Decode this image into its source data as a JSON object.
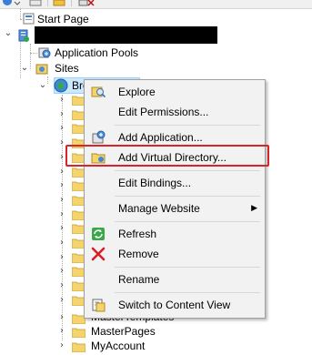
{
  "tree": {
    "start_page": "Start Page",
    "server_name_redacted": true,
    "application_pools": "Application Pools",
    "sites": "Sites",
    "site_partial": "Bro",
    "bottom_items": [
      "MasterTemplates",
      "MasterPages",
      "MyAccount"
    ]
  },
  "context_menu": {
    "items": [
      {
        "label": "Explore",
        "icon": "explore-icon"
      },
      {
        "label": "Edit Permissions...",
        "icon": ""
      },
      {
        "label": "Add Application...",
        "icon": "add-application-icon"
      },
      {
        "label": "Add Virtual Directory...",
        "icon": "add-virtual-directory-icon",
        "highlighted": true
      },
      {
        "label": "Edit Bindings...",
        "icon": ""
      },
      {
        "label": "Manage Website",
        "icon": "",
        "submenu": true
      },
      {
        "label": "Refresh",
        "icon": "refresh-icon"
      },
      {
        "label": "Remove",
        "icon": "remove-icon"
      },
      {
        "label": "Rename",
        "icon": ""
      },
      {
        "label": "Switch to Content View",
        "icon": "content-view-icon"
      }
    ]
  },
  "colors": {
    "highlight_border": "#d8232a",
    "menu_background": "#f2f2f2",
    "folder_yellow": "#f5d46b"
  }
}
